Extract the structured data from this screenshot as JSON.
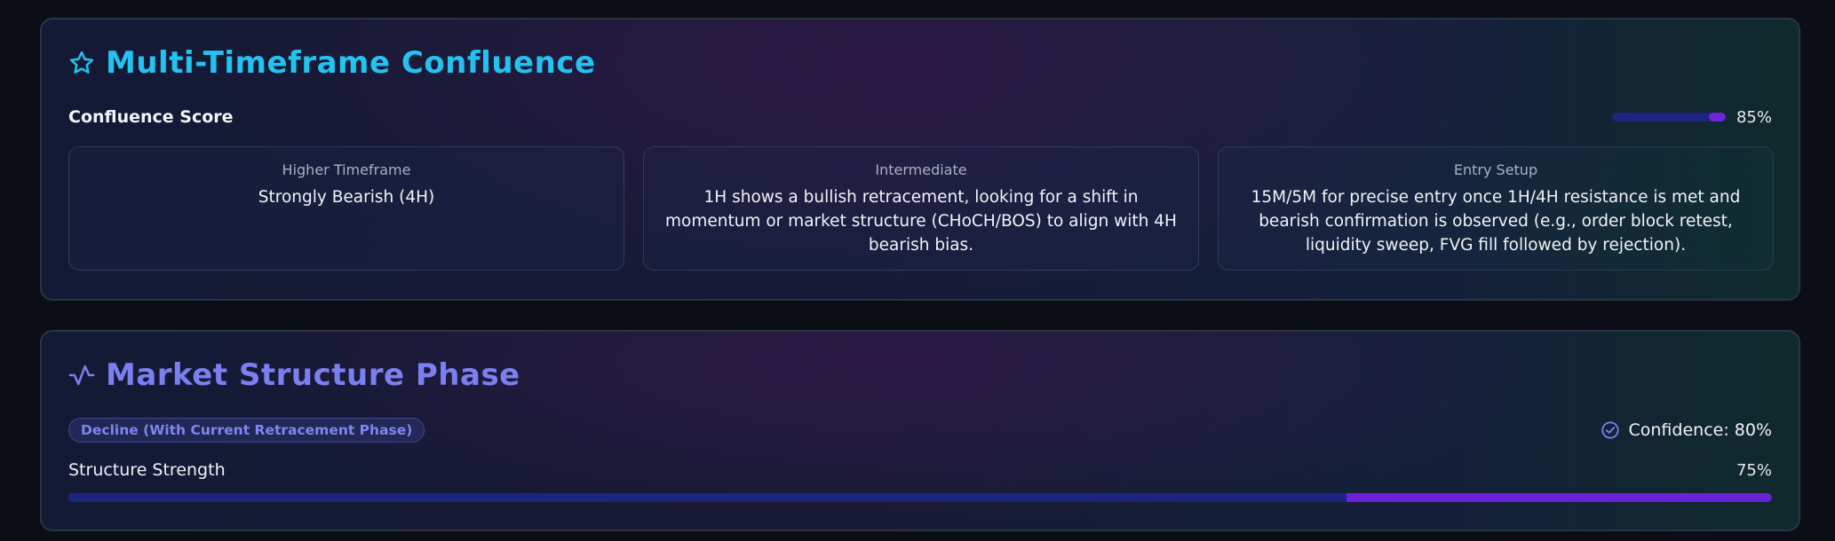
{
  "confluence": {
    "title": "Multi-Timeframe Confluence",
    "icon": "star-icon",
    "score_label": "Confluence Score",
    "score_value": 0.85,
    "score_text": "85%",
    "panels": [
      {
        "heading": "Higher Timeframe",
        "body": "Strongly Bearish (4H)"
      },
      {
        "heading": "Intermediate",
        "body": "1H shows a bullish retracement, looking for a shift in momentum or market structure (CHoCH/BOS) to align with 4H bearish bias."
      },
      {
        "heading": "Entry Setup",
        "body": "15M/5M for precise entry once 1H/4H resistance is met and bearish confirmation is observed (e.g., order block retest, liquidity sweep, FVG fill followed by rejection)."
      }
    ]
  },
  "structure": {
    "title": "Market Structure Phase",
    "icon": "activity-icon",
    "phase_badge": "Decline (With Current Retracement Phase)",
    "confidence_icon": "check-circle-icon",
    "confidence_text": "Confidence: 80%",
    "strength_label": "Structure Strength",
    "strength_value": 0.75,
    "strength_text": "75%"
  },
  "colors": {
    "accent_cyan": "#22c3ef",
    "accent_indigo": "#7b7ff0",
    "progress_track": "#1c2680",
    "progress_fill": "#6a21d8"
  }
}
